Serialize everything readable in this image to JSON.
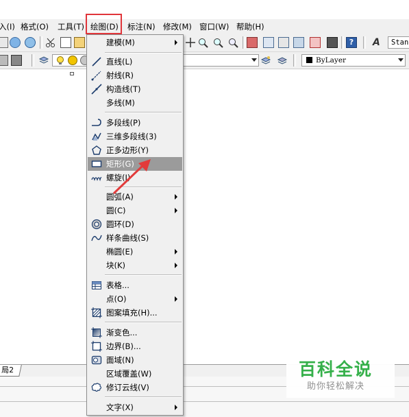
{
  "menubar": {
    "items": [
      {
        "label": "入(I)"
      },
      {
        "label": "格式(O)"
      },
      {
        "label": "工具(T)"
      },
      {
        "label": "绘图(D)"
      },
      {
        "label": "标注(N)"
      },
      {
        "label": "修改(M)"
      },
      {
        "label": "窗口(W)"
      },
      {
        "label": "帮助(H)"
      }
    ]
  },
  "toolbar": {
    "style_combo_value": "Stan",
    "linetype_combo_value": "ByLayer"
  },
  "layout_tabs": {
    "tab_label": "局2"
  },
  "draw_menu": {
    "items": [
      {
        "label": "建模(M)",
        "submenu": true,
        "icon": "none"
      },
      {
        "label": "直线(L)",
        "icon": "line-icon"
      },
      {
        "label": "射线(R)",
        "icon": "ray-icon"
      },
      {
        "label": "构造线(T)",
        "icon": "xline-icon"
      },
      {
        "label": "多线(M)",
        "icon": "none"
      },
      {
        "label": "多段线(P)",
        "icon": "polyline-icon"
      },
      {
        "label": "三维多段线(3)",
        "icon": "3dpolyline-icon"
      },
      {
        "label": "正多边形(Y)",
        "icon": "polygon-icon"
      },
      {
        "label": "矩形(G)",
        "icon": "rectangle-icon",
        "highlighted": true
      },
      {
        "label": "螺旋(I)",
        "icon": "helix-icon"
      },
      {
        "label": "圆弧(A)",
        "submenu": true,
        "icon": "none"
      },
      {
        "label": "圆(C)",
        "submenu": true,
        "icon": "none"
      },
      {
        "label": "圆环(D)",
        "icon": "donut-icon"
      },
      {
        "label": "样条曲线(S)",
        "icon": "spline-icon"
      },
      {
        "label": "椭圆(E)",
        "submenu": true,
        "icon": "none"
      },
      {
        "label": "块(K)",
        "submenu": true,
        "icon": "none"
      },
      {
        "label": "表格...",
        "icon": "table-icon"
      },
      {
        "label": "点(O)",
        "submenu": true,
        "icon": "none"
      },
      {
        "label": "图案填充(H)...",
        "icon": "hatch-icon"
      },
      {
        "label": "渐变色...",
        "icon": "gradient-icon"
      },
      {
        "label": "边界(B)...",
        "icon": "boundary-icon"
      },
      {
        "label": "面域(N)",
        "icon": "region-icon"
      },
      {
        "label": "区域覆盖(W)",
        "icon": "none"
      },
      {
        "label": "修订云线(V)",
        "icon": "revcloud-icon"
      },
      {
        "label": "文字(X)",
        "submenu": true,
        "icon": "none"
      }
    ]
  },
  "watermark": {
    "title": "百科全说",
    "subtitle": "助你轻松解决"
  },
  "colors": {
    "highlight_border": "#e0353a",
    "arrow": "#e23b3b",
    "watermark_green": "#2fae45",
    "menu_bg": "#f0f0f0",
    "selected_item_bg": "#9b9b9b"
  }
}
